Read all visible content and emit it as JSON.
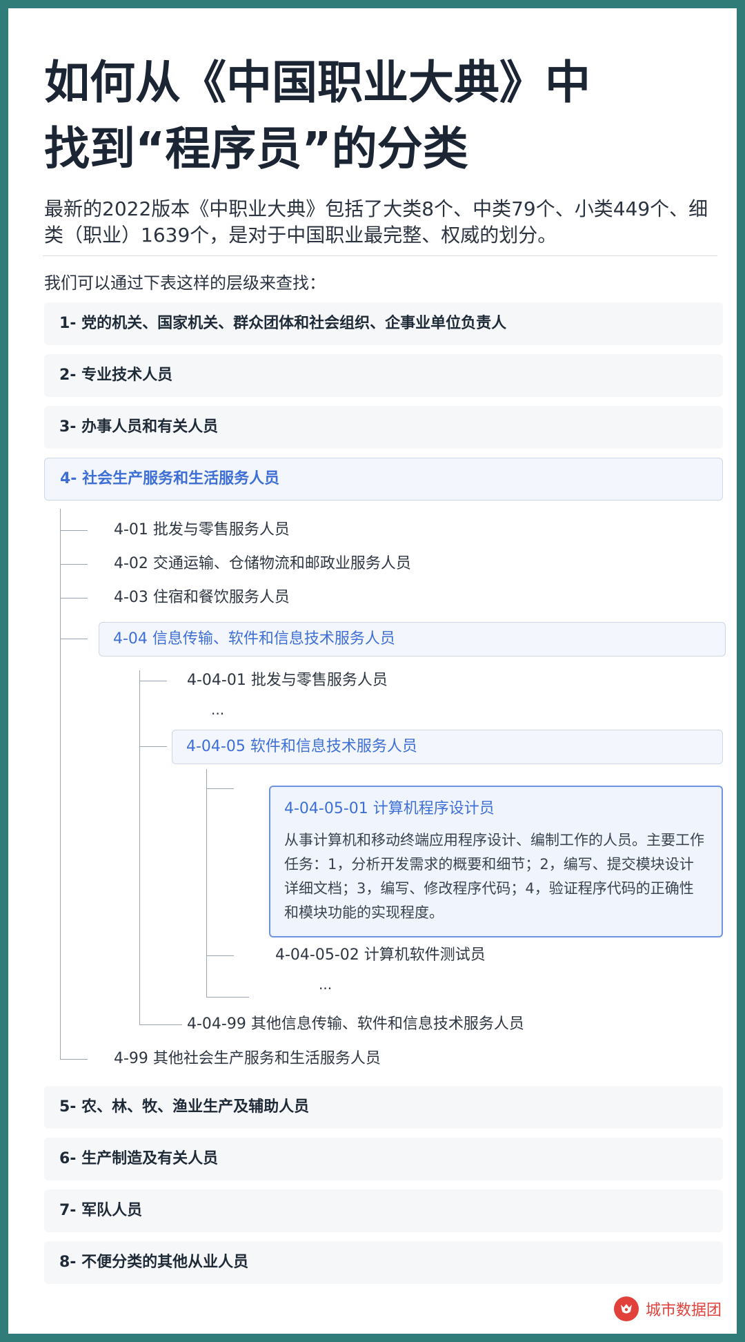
{
  "title_line1": "如何从《中国职业大典》中",
  "title_line2": "找到“程序员”的分类",
  "intro": "最新的2022版本《中职业大典》包括了大类8个、中类79个、小类449个、细类（职业）1639个，是对于中国职业最完整、权威的划分。",
  "lead": "我们可以通过下表这样的层级来查找：",
  "majors": [
    "1- 党的机关、国家机关、群众团体和社会组织、企事业单位负责人",
    "2- 专业技术人员",
    "3- 办事人员和有关人员",
    "4- 社会生产服务和生活服务人员",
    "5- 农、林、牧、渔业生产及辅助人员",
    "6- 生产制造及有关人员",
    "7- 军队人员",
    "8- 不便分类的其他从业人员"
  ],
  "mid": {
    "m401": "4-01 批发与零售服务人员",
    "m402": "4-02 交通运输、仓储物流和邮政业服务人员",
    "m403": "4-03 住宿和餐饮服务人员",
    "m404": "4-04 信息传输、软件和信息技术服务人员",
    "m499": "4-99 其他社会生产服务和生活服务人员"
  },
  "small": {
    "s40401": "4-04-01 批发与零售服务人员",
    "ellipsis1": "...",
    "s40405": "4-04-05 软件和信息技术服务人员",
    "s40499": "4-04-99 其他信息传输、软件和信息技术服务人员"
  },
  "detail": {
    "title": "4-04-05-01 计算机程序设计员",
    "body": "从事计算机和移动终端应用程序设计、编制工作的人员。主要工作任务：1，分析开发需求的概要和细节；2，编写、提交模块设计详细文档；3，编写、修改程序代码；4，验证程序代码的正确性和模块功能的实现程度。"
  },
  "fine": {
    "f0502": "4-04-05-02 计算机软件测试员",
    "ellipsis2": "..."
  },
  "brand": "城市数据团",
  "colors": {
    "accent": "#3d6fd6",
    "frame": "#2f7c78",
    "brand": "#e1413a"
  }
}
